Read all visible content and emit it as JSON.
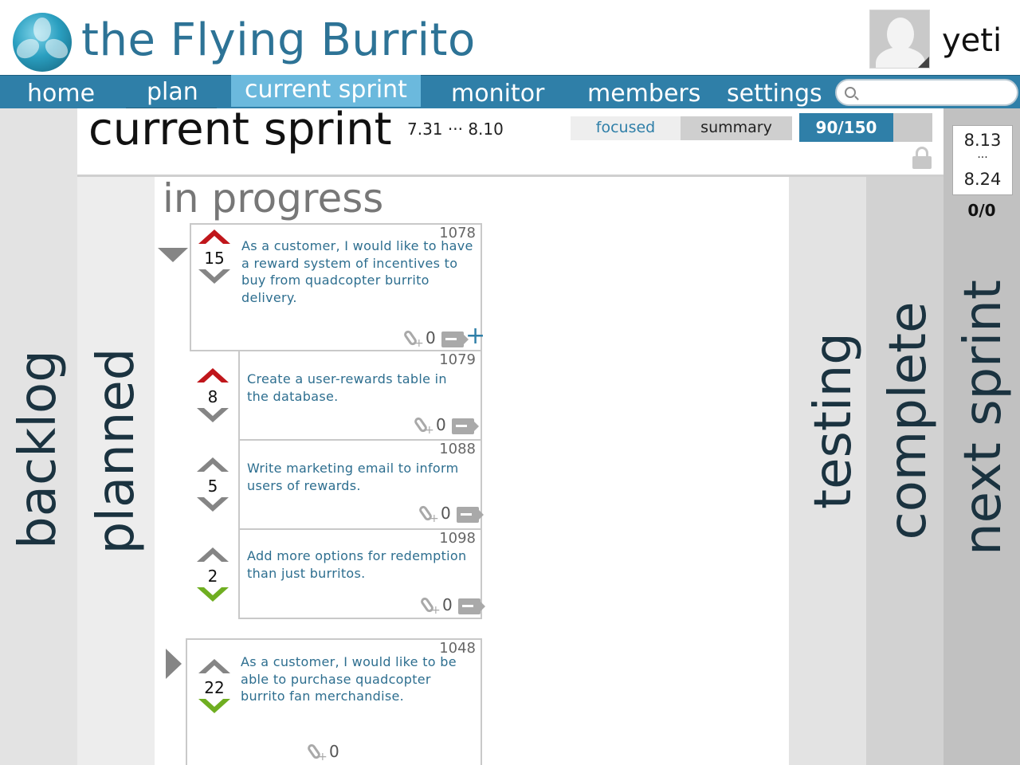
{
  "app": {
    "title": "the Flying Burrito"
  },
  "user": {
    "name": "yeti"
  },
  "nav": {
    "tabs": [
      "home",
      "plan",
      "current sprint",
      "monitor",
      "members",
      "settings"
    ],
    "active": "current sprint",
    "search_placeholder": ""
  },
  "sprint": {
    "title": "current sprint",
    "dates": "7.31 ··· 8.10",
    "view_tabs": [
      "focused",
      "summary"
    ],
    "active_view": "focused",
    "capacity_label": "90/150",
    "capacity_fraction": 0.6
  },
  "next_sprint": {
    "start": "8.13",
    "separator": "···",
    "end": "8.24",
    "capacity": "0/0"
  },
  "columns": [
    "backlog",
    "planned",
    "in progress",
    "testing",
    "complete",
    "next sprint"
  ],
  "in_progress": {
    "title": "in progress",
    "stories": [
      {
        "id": "1078",
        "points": "15",
        "up": "red",
        "down": "gray",
        "text": "As a customer, I would like to have a reward system of incentives to buy from quadcopter burrito delivery.",
        "attachments": "0",
        "expanded": true,
        "tasks": [
          {
            "id": "1079",
            "points": "8",
            "up": "red",
            "down": "gray",
            "text": "Create a user-rewards table in the database.",
            "attachments": "0"
          },
          {
            "id": "1088",
            "points": "5",
            "up": "gray",
            "down": "gray",
            "text": "Write marketing email to inform users of rewards.",
            "attachments": "0"
          },
          {
            "id": "1098",
            "points": "2",
            "up": "gray",
            "down": "green",
            "text": "Add more options for redemption than just burritos.",
            "attachments": "0"
          }
        ]
      },
      {
        "id": "1048",
        "points": "22",
        "up": "gray",
        "down": "green",
        "text": "As a customer, I would like to be able to purchase quadcopter burrito fan merchandise.",
        "attachments": "0",
        "expanded": false
      }
    ]
  },
  "colors": {
    "brand": "#2d7396",
    "nav": "#2f7fa8",
    "nav_active": "#6bb9dd",
    "vote_up": "#c0161b",
    "vote_down": "#6fae21"
  },
  "icons": [
    "logo-icon",
    "search-icon",
    "lock-icon",
    "attachment-icon",
    "comment-icon",
    "add-icon",
    "collapse-arrow-icon",
    "expand-arrow-icon"
  ]
}
